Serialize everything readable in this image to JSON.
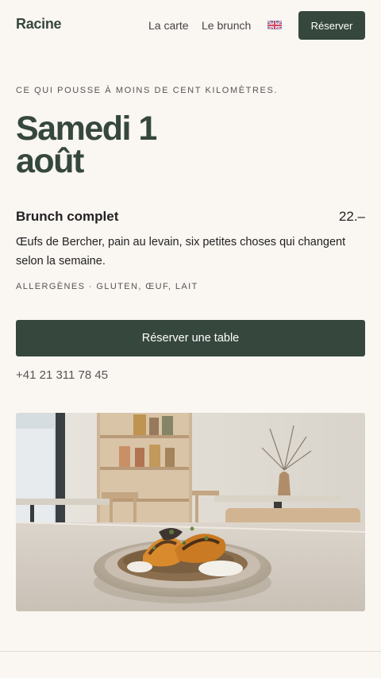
{
  "header": {
    "brand": "Racine",
    "nav": [
      {
        "label": "La carte"
      },
      {
        "label": "Le brunch"
      }
    ],
    "reserve_label": "Réserver"
  },
  "hero": {
    "tagline": "CE QUI POUSSE À MOINS DE CENT KILOMÈTRES.",
    "date_line1": "Samedi 1",
    "date_line2": "août"
  },
  "menu_item": {
    "name": "Brunch complet",
    "price": "22.–",
    "description": "Œufs de Bercher, pain au levain, six petites choses qui changent selon la semaine.",
    "allergens": "ALLERGÈNES · GLUTEN, ŒUF, LAIT"
  },
  "cta": {
    "label": "Réserver une table",
    "phone": "+41 21 311 78 45"
  },
  "colors": {
    "accent": "#36473d",
    "background": "#faf6f2"
  }
}
